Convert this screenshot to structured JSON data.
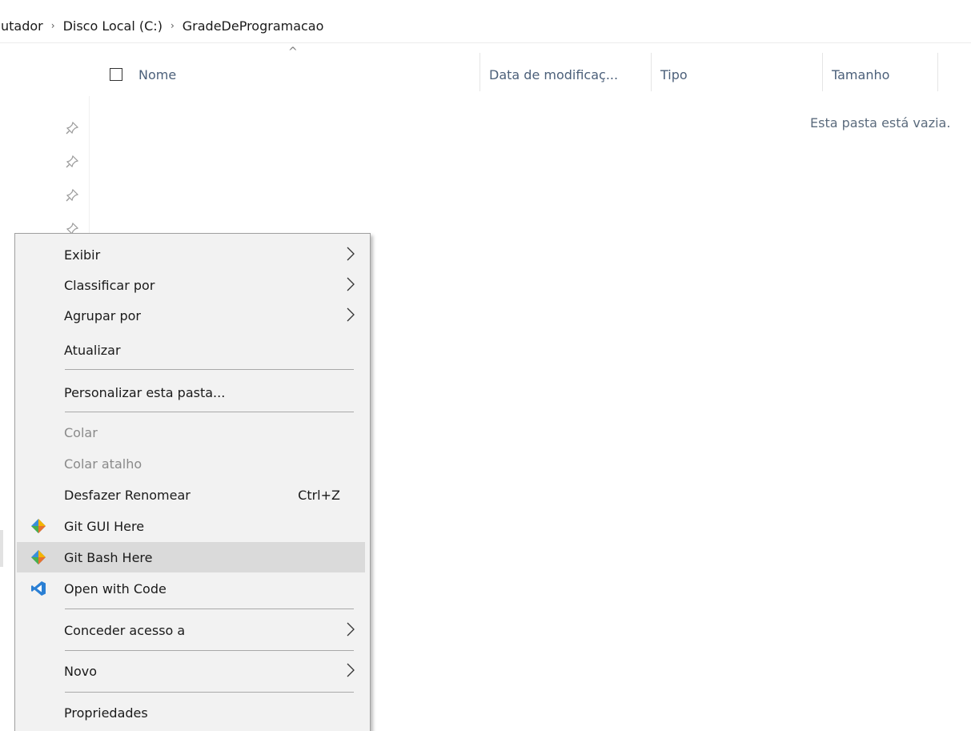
{
  "breadcrumb": {
    "items": [
      "utador",
      "Disco Local (C:)",
      "GradeDeProgramacao"
    ],
    "separator": "›"
  },
  "columns": {
    "name": "Nome",
    "date": "Data de modificaç...",
    "type": "Tipo",
    "size": "Tamanho",
    "sort_indicator": "^"
  },
  "empty_message": "Esta pasta está vazia.",
  "context_menu": {
    "view": "Exibir",
    "sort_by": "Classificar por",
    "group_by": "Agrupar por",
    "refresh": "Atualizar",
    "customize": "Personalizar esta pasta...",
    "paste": "Colar",
    "paste_shortcut": "Colar atalho",
    "undo_rename": "Desfazer Renomear",
    "undo_rename_shortcut": "Ctrl+Z",
    "git_gui": "Git GUI Here",
    "git_bash": "Git Bash Here",
    "open_code": "Open with Code",
    "grant_access": "Conceder acesso a",
    "new": "Novo",
    "properties": "Propriedades"
  },
  "icons": {
    "pin": "pin-icon",
    "git": "git-icon",
    "vscode": "vscode-icon",
    "chevron": "chevron-right-icon"
  },
  "colors": {
    "menu_background": "#f2f2f2",
    "menu_highlight": "#dadada",
    "header_text": "#4c607a",
    "vscode_blue": "#2a7fd4",
    "git_orange": "#f05033"
  }
}
